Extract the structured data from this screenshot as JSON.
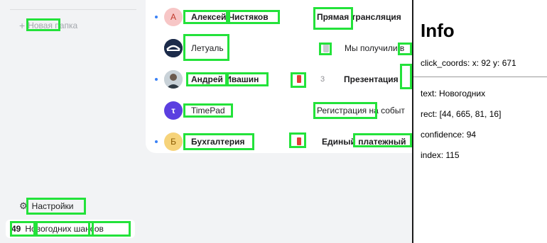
{
  "sidebar": {
    "new_folder": "Новая папка",
    "settings": "Настройки",
    "promo_count": "49",
    "promo_text": "Новогодних шансов"
  },
  "mail_rows": [
    {
      "sender": "Алексей Чистяков",
      "avatar_letter": "А",
      "avatar_color": "#f7c6c6",
      "avatar_text_color": "#c0392b",
      "subject": "Прямая трансляция",
      "unread": true
    },
    {
      "sender": "Летуаль",
      "avatar_letter": "",
      "avatar_color": "#1c2b4a",
      "avatar_text_color": "#ffffff",
      "subject": "Мы получили в",
      "unread": false
    },
    {
      "sender": "Андрей Ивашин",
      "avatar_letter": "",
      "avatar_color": "#b9c4cc",
      "avatar_text_color": "#ffffff",
      "count": "3",
      "subject": "Презентация",
      "unread": true,
      "flag": true
    },
    {
      "sender": "TimePad",
      "avatar_letter": "τ",
      "avatar_color": "#5b3fe0",
      "avatar_text_color": "#ffffff",
      "subject": "Регистрация на событ",
      "unread": false
    },
    {
      "sender": "Бухгалтерия",
      "avatar_letter": "Б",
      "avatar_color": "#f6d37a",
      "avatar_text_color": "#8a5a00",
      "subject": "Единый платежный",
      "unread": true,
      "flag": true
    }
  ],
  "info": {
    "title": "Info",
    "click_coords": "click_coords: x: 92 y: 671",
    "text": "text: Новогодних",
    "rect": "rect: [44, 665, 81, 16]",
    "confidence": "confidence: 94",
    "index": "index: 115"
  },
  "colors": {
    "highlight": "#23e23a",
    "unread_dot": "#3b82f6",
    "flag": "#e53935"
  }
}
